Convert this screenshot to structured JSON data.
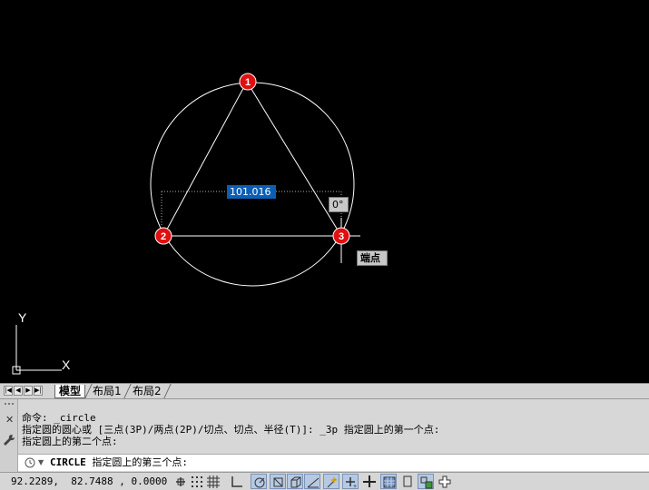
{
  "canvas": {
    "dynamic_input_value": "101.016",
    "angle_tooltip": "0°",
    "snap_tooltip": "端点",
    "point_markers": [
      "1",
      "2",
      "3"
    ],
    "ucs": {
      "x_label": "X",
      "y_label": "Y"
    }
  },
  "tabs": {
    "items": [
      {
        "label": "模型",
        "active": true
      },
      {
        "label": "布局1",
        "active": false
      },
      {
        "label": "布局2",
        "active": false
      }
    ],
    "nav_icons": [
      "first-tab-icon",
      "prev-tab-icon",
      "next-tab-icon",
      "last-tab-icon"
    ]
  },
  "command": {
    "history": [
      "命令: _circle",
      "指定圆的圆心或 [三点(3P)/两点(2P)/切点、切点、半径(T)]: _3p 指定圆上的第一个点:",
      "指定圆上的第二个点:"
    ],
    "current_command": "CIRCLE",
    "current_prompt": "指定圆上的第三个点:"
  },
  "status": {
    "coordinates": "92.2289,  82.7488 , 0.0000",
    "toggles": [
      {
        "name": "infer-constraints",
        "on": false
      },
      {
        "name": "snap-mode",
        "on": false
      },
      {
        "name": "grid-display",
        "on": false
      },
      {
        "name": "ortho-mode",
        "on": false
      },
      {
        "name": "polar-tracking",
        "on": true
      },
      {
        "name": "object-snap",
        "on": true
      },
      {
        "name": "3d-object-snap",
        "on": true
      },
      {
        "name": "object-snap-tracking",
        "on": true
      },
      {
        "name": "dynamic-ucs",
        "on": true
      },
      {
        "name": "dynamic-input",
        "on": true
      },
      {
        "name": "lineweight",
        "on": false
      },
      {
        "name": "transparency",
        "on": true
      },
      {
        "name": "quick-properties",
        "on": false
      },
      {
        "name": "selection-cycling",
        "on": true
      },
      {
        "name": "annotation-monitor",
        "on": false
      }
    ]
  }
}
